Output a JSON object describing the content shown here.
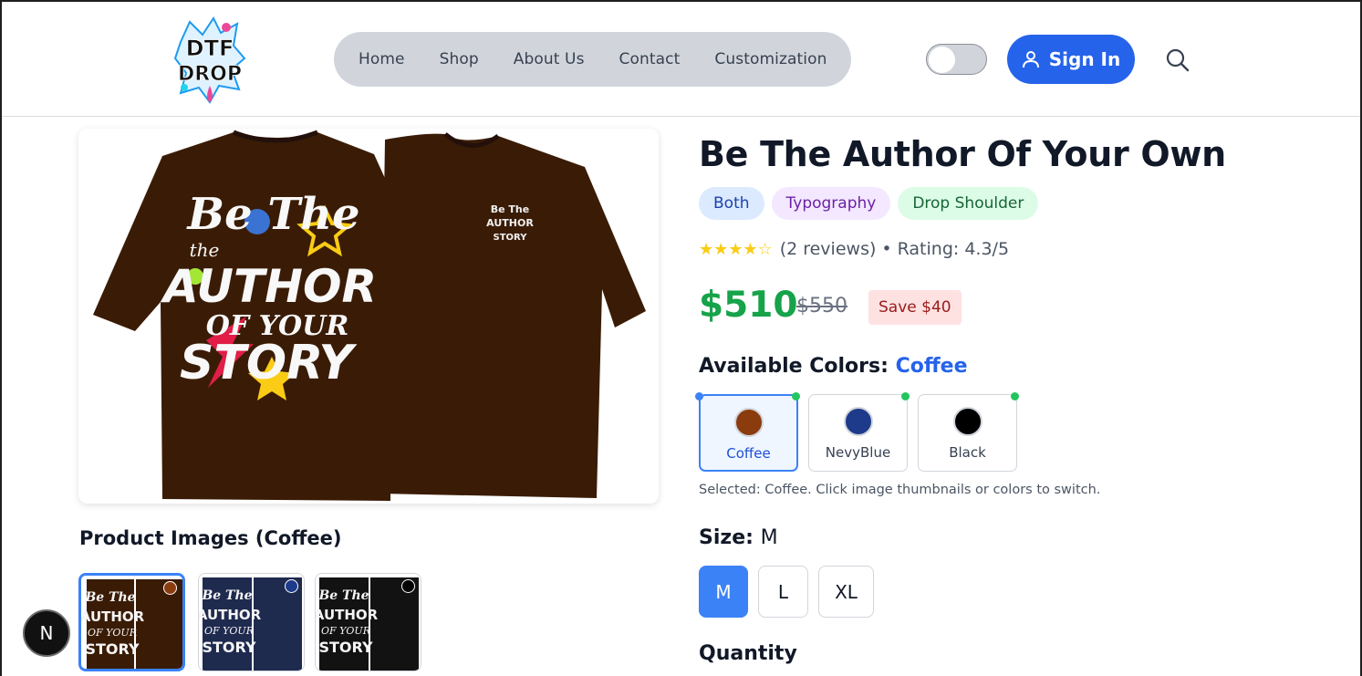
{
  "header": {
    "logo_text_top": "DTF",
    "logo_text_bottom": "DROP",
    "nav": [
      {
        "label": "Home"
      },
      {
        "label": "Shop"
      },
      {
        "label": "About Us"
      },
      {
        "label": "Contact"
      },
      {
        "label": "Customization"
      }
    ],
    "theme_toggle_on": false,
    "sign_in_label": "Sign In"
  },
  "product": {
    "title": "Be The Author Of Your Own",
    "tags": [
      "Both",
      "Typography",
      "Drop Shoulder"
    ],
    "stars": "★★★★☆",
    "reviews": "(2 reviews)",
    "rating_text": "• Rating: 4.3/5",
    "price": "$510",
    "old_price": "$550",
    "save": "Save $40",
    "colors_label": "Available Colors:",
    "selected_color": "Coffee",
    "colors": [
      {
        "name": "Coffee",
        "hex": "#8b3c0f"
      },
      {
        "name": "NevyBlue",
        "hex": "#1e3a8a"
      },
      {
        "name": "Black",
        "hex": "#000000"
      }
    ],
    "hint": "Selected: Coffee. Click image thumbnails or colors to switch.",
    "size_label": "Size:",
    "selected_size": "M",
    "sizes": [
      "M",
      "L",
      "XL"
    ],
    "quantity_label": "Quantity"
  },
  "gallery": {
    "title": "Product Images (Coffee)",
    "thumbnails": [
      {
        "color": "Coffee",
        "shirt_hex": "#3a1c06",
        "dot_hex": "#8b3c0f"
      },
      {
        "color": "NevyBlue",
        "shirt_hex": "#1f2a4f",
        "dot_hex": "#1e3a8a"
      },
      {
        "color": "Black",
        "shirt_hex": "#121212",
        "dot_hex": "#000000"
      }
    ],
    "print_lines": [
      "Be The",
      "the",
      "AUTHOR",
      "OF YOUR",
      "STORY"
    ]
  },
  "floating_badge": "N",
  "colors": {
    "accent": "#2563eb",
    "price_green": "#16a34a",
    "shirt_coffee": "#3a1c06"
  }
}
